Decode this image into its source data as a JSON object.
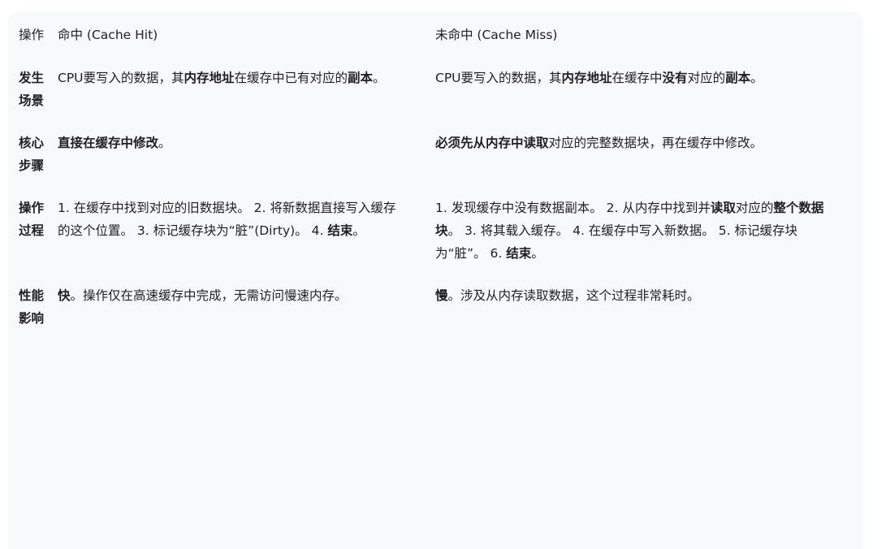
{
  "table": {
    "headers": {
      "op": "操作",
      "hit": "命中 (Cache Hit)",
      "miss": "未命中 (Cache Miss)"
    },
    "rows": [
      {
        "label": "发生场景",
        "hit": [
          {
            "t": "CPU要写入的数据，其"
          },
          {
            "t": "内存地址",
            "b": true
          },
          {
            "t": "在缓存中已有对应的"
          },
          {
            "t": "副本",
            "b": true
          },
          {
            "t": "。"
          }
        ],
        "miss": [
          {
            "t": "CPU要写入的数据，其"
          },
          {
            "t": "内存地址",
            "b": true
          },
          {
            "t": "在缓存中"
          },
          {
            "t": "没有",
            "b": true
          },
          {
            "t": "对应的"
          },
          {
            "t": "副本",
            "b": true
          },
          {
            "t": "。"
          }
        ]
      },
      {
        "label": "核心步骤",
        "hit": [
          {
            "t": "直接在缓存中修改",
            "b": true
          },
          {
            "t": "。"
          }
        ],
        "miss": [
          {
            "t": "必须先从内存中读取",
            "b": true
          },
          {
            "t": "对应的完整数据块，再在缓存中修改。"
          }
        ]
      },
      {
        "label": "操作过程",
        "hit": [
          {
            "t": "1. 在缓存中找到对应的旧数据块。 2. 将新数据直接写入缓存的这个位置。 3. 标记缓存块为“脏”(Dirty)。 4. "
          },
          {
            "t": "结束",
            "b": true
          },
          {
            "t": "。"
          }
        ],
        "miss": [
          {
            "t": "1. 发现缓存中没有数据副本。 2. 从内存中找到并"
          },
          {
            "t": "读取",
            "b": true
          },
          {
            "t": "对应的"
          },
          {
            "t": "整个数据块",
            "b": true
          },
          {
            "t": "。 3. 将其载入缓存。 4. 在缓存中写入新数据。 5. 标记缓存块为“脏”。 6. "
          },
          {
            "t": "结束",
            "b": true
          },
          {
            "t": "。"
          }
        ]
      },
      {
        "label": "性能影响",
        "hit": [
          {
            "t": "快",
            "b": true
          },
          {
            "t": "。操作仅在高速缓存中完成，无需访问慢速内存。"
          }
        ],
        "miss": [
          {
            "t": "慢",
            "b": true
          },
          {
            "t": "。涉及从内存读取数据，这个过程非常耗时。"
          }
        ]
      }
    ]
  }
}
